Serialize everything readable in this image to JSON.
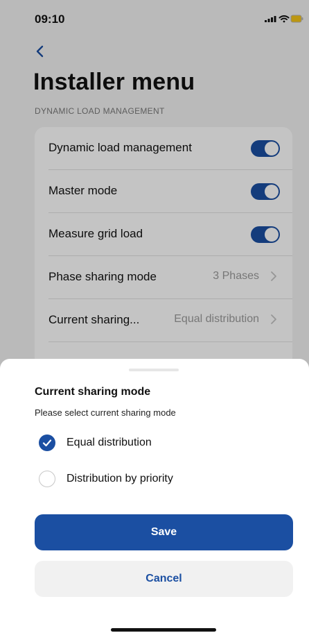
{
  "status_bar": {
    "time": "09:10"
  },
  "header": {
    "title": "Installer menu"
  },
  "section": {
    "header": "DYNAMIC LOAD MANAGEMENT"
  },
  "settings": {
    "rows": [
      {
        "label": "Dynamic load management",
        "type": "toggle",
        "on": true
      },
      {
        "label": "Master mode",
        "type": "toggle",
        "on": true
      },
      {
        "label": "Measure grid load",
        "type": "toggle",
        "on": true
      },
      {
        "label": "Phase sharing mode",
        "type": "value",
        "value": "3 Phases"
      },
      {
        "label": "Current sharing...",
        "type": "value",
        "value": "Equal distribution"
      }
    ]
  },
  "sheet": {
    "title": "Current sharing mode",
    "subtitle": "Please select current sharing mode",
    "options": [
      {
        "label": "Equal distribution",
        "selected": true
      },
      {
        "label": "Distribution by priority",
        "selected": false
      }
    ],
    "save_label": "Save",
    "cancel_label": "Cancel"
  },
  "colors": {
    "accent": "#1b4fa2",
    "background": "#f2f2f2",
    "card": "#ffffff",
    "secondary_text": "#9b9b9b"
  },
  "icons": {
    "back": "chevron-left-icon",
    "row_disclosure": "chevron-right-icon",
    "signal": "signal-icon",
    "wifi": "wifi-icon",
    "battery": "battery-icon",
    "check": "checkmark-icon"
  }
}
